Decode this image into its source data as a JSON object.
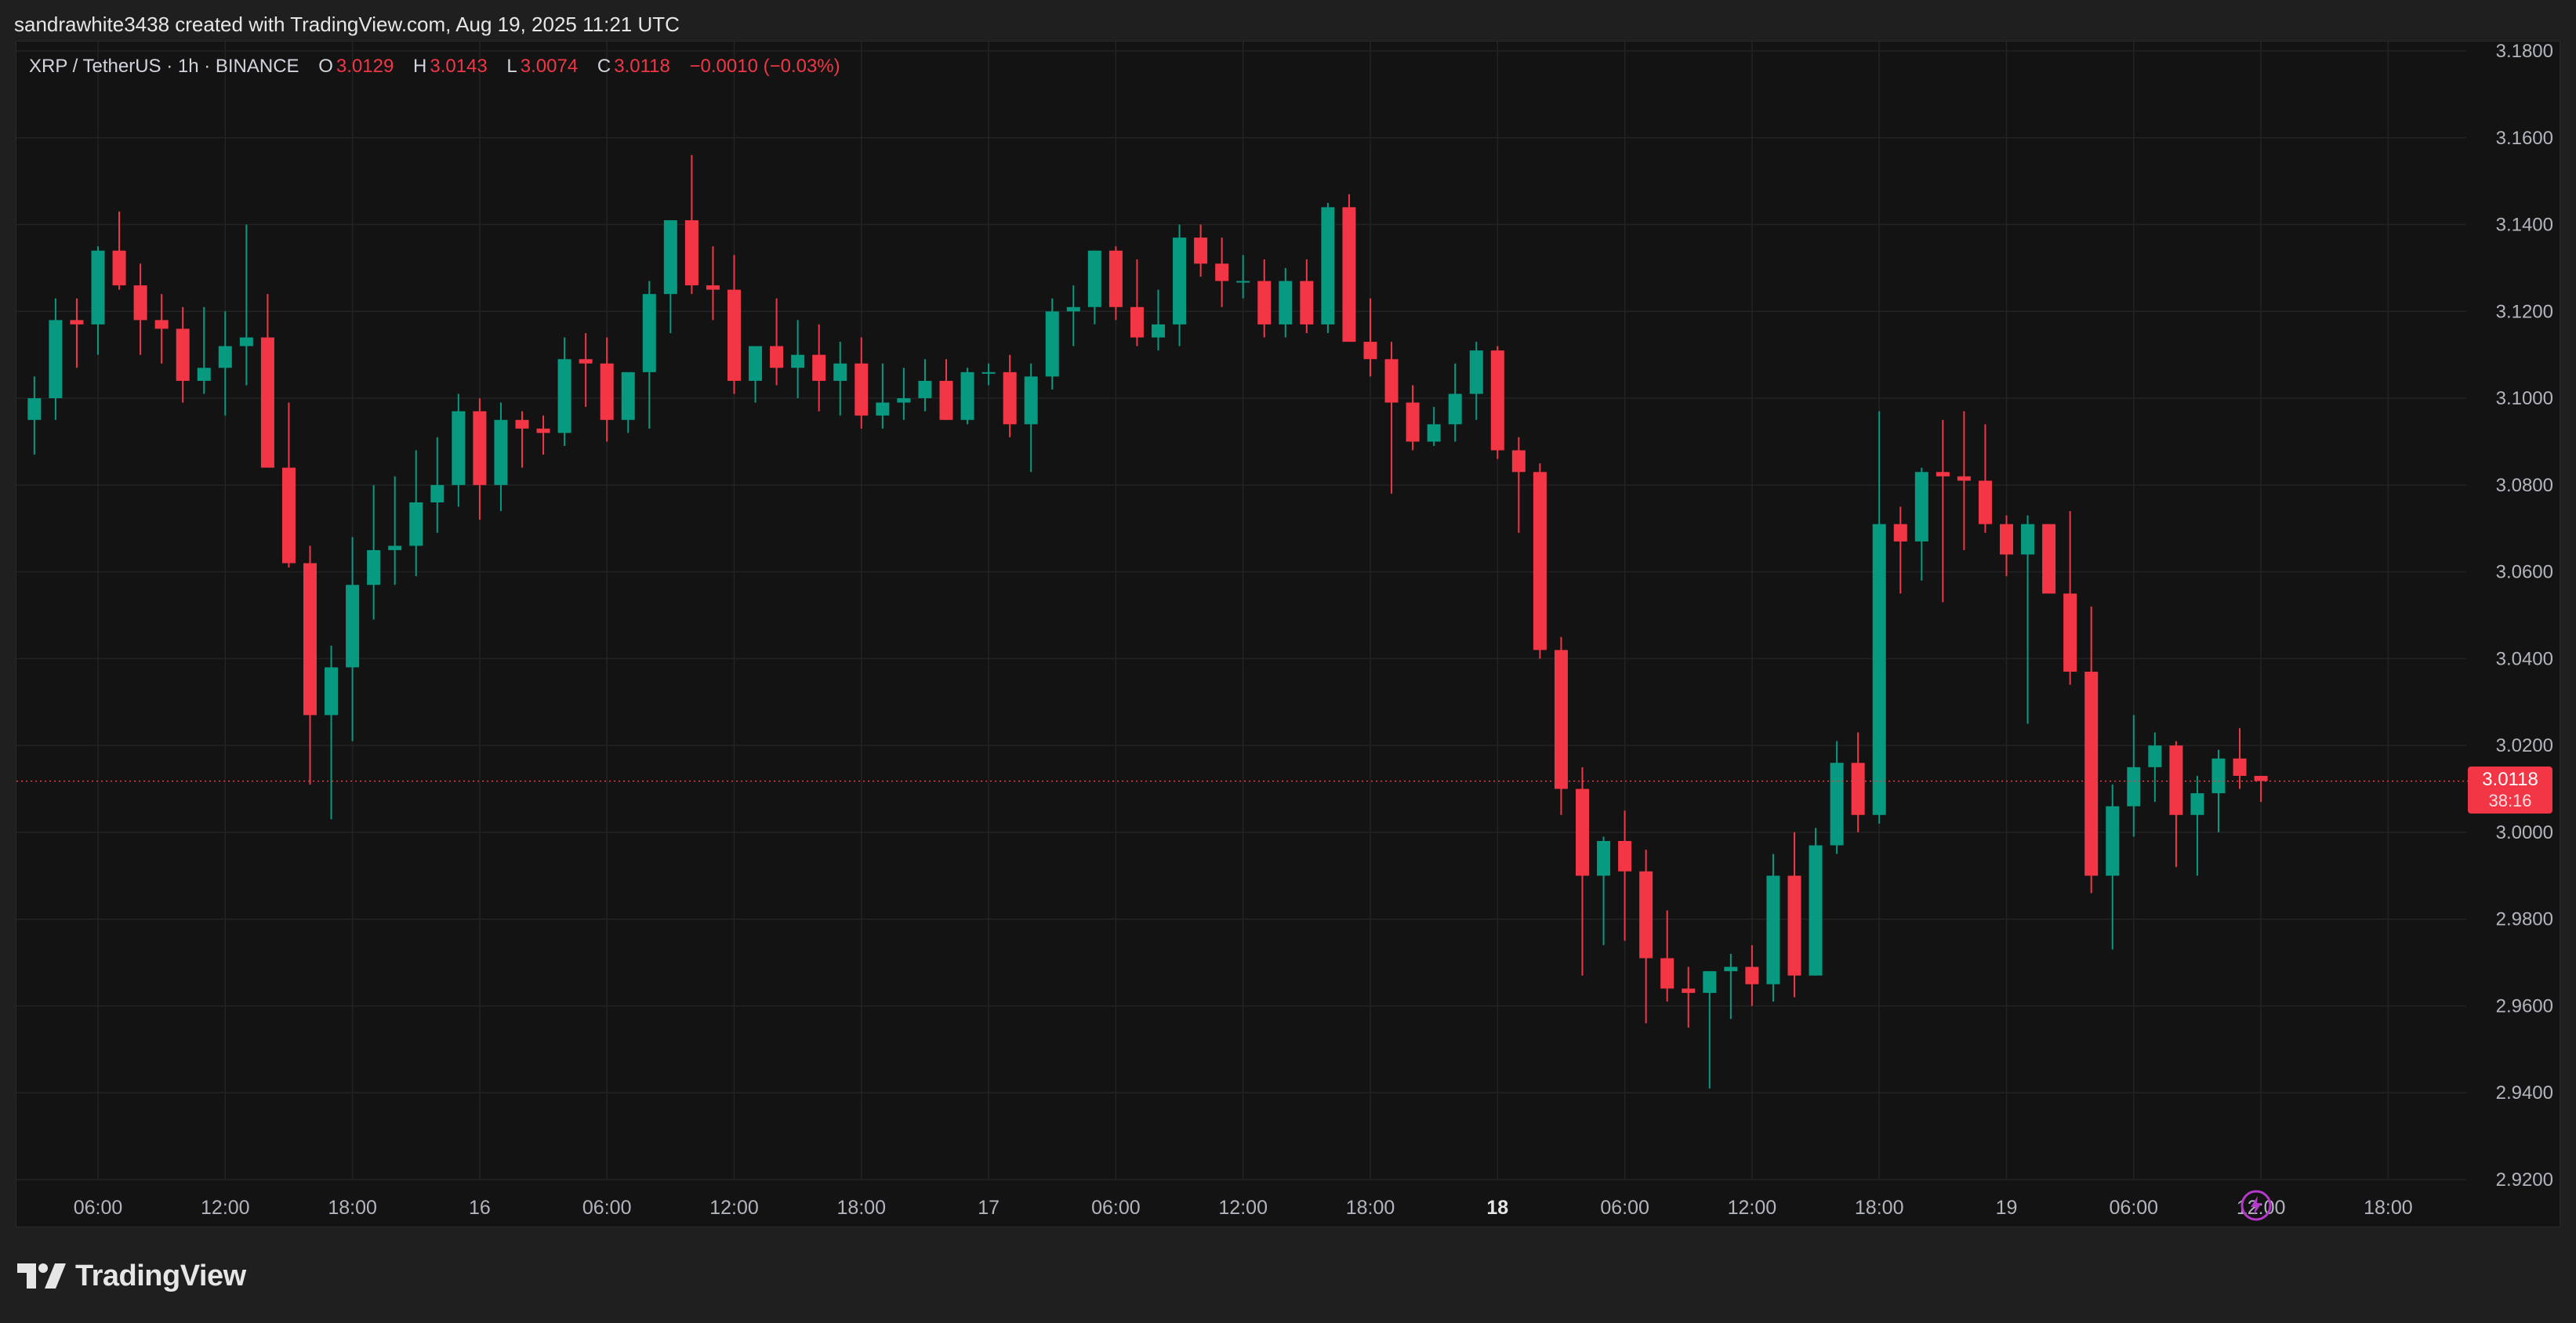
{
  "attribution": "sandrawhite3438 created with TradingView.com, Aug 19, 2025 11:21 UTC",
  "legend": {
    "symbol": "XRP / TetherUS · 1h · BINANCE",
    "o_label": "O",
    "o_value": "3.0129",
    "h_label": "H",
    "h_value": "3.0143",
    "l_label": "L",
    "l_value": "3.0074",
    "c_label": "C",
    "c_value": "3.0118",
    "change": "−0.0010 (−0.03%)"
  },
  "last_price": {
    "price": "3.0118",
    "countdown": "38:16"
  },
  "brand": "TradingView",
  "colors": {
    "up": "#089981",
    "down": "#f23645",
    "background": "#131313",
    "grid": "#232323",
    "axis_text": "#b2b5be"
  },
  "icons": {
    "replay": "lightning-icon",
    "logo": "tradingview-logo-icon"
  },
  "chart_data": {
    "type": "candlestick",
    "symbol": "XRP / TetherUS",
    "interval": "1h",
    "exchange": "BINANCE",
    "ylim": [
      2.92,
      3.18
    ],
    "y_ticks": [
      3.18,
      3.16,
      3.14,
      3.12,
      3.1,
      3.08,
      3.06,
      3.04,
      3.02,
      3.0,
      2.98,
      2.96,
      2.94,
      2.92
    ],
    "y_tick_labels": [
      "3.1800",
      "3.1600",
      "3.1400",
      "3.1200",
      "3.1000",
      "3.0800",
      "3.0600",
      "3.0400",
      "3.0200",
      "3.0000",
      "2.9800",
      "2.9600",
      "2.9400",
      "2.9200"
    ],
    "x_ticks": [
      {
        "label": "06:00",
        "hour": 6
      },
      {
        "label": "12:00",
        "hour": 12
      },
      {
        "label": "18:00",
        "hour": 18
      },
      {
        "label": "16",
        "hour": 24
      },
      {
        "label": "06:00",
        "hour": 30
      },
      {
        "label": "12:00",
        "hour": 36
      },
      {
        "label": "18:00",
        "hour": 42
      },
      {
        "label": "17",
        "hour": 48
      },
      {
        "label": "06:00",
        "hour": 54
      },
      {
        "label": "12:00",
        "hour": 60
      },
      {
        "label": "18:00",
        "hour": 66
      },
      {
        "label": "18",
        "hour": 72,
        "bold": true
      },
      {
        "label": "06:00",
        "hour": 78
      },
      {
        "label": "12:00",
        "hour": 84
      },
      {
        "label": "18:00",
        "hour": 90
      },
      {
        "label": "19",
        "hour": 96
      },
      {
        "label": "06:00",
        "hour": 102
      },
      {
        "label": "12:00",
        "hour": 108
      },
      {
        "label": "18:00",
        "hour": 114
      }
    ],
    "first_candle_hour": 3,
    "candles": [
      [
        3.095,
        3.105,
        3.087,
        3.1
      ],
      [
        3.1,
        3.123,
        3.095,
        3.118
      ],
      [
        3.118,
        3.123,
        3.107,
        3.117
      ],
      [
        3.117,
        3.135,
        3.11,
        3.134
      ],
      [
        3.134,
        3.143,
        3.125,
        3.126
      ],
      [
        3.126,
        3.131,
        3.11,
        3.118
      ],
      [
        3.118,
        3.124,
        3.108,
        3.116
      ],
      [
        3.116,
        3.121,
        3.099,
        3.104
      ],
      [
        3.104,
        3.121,
        3.101,
        3.107
      ],
      [
        3.107,
        3.12,
        3.096,
        3.112
      ],
      [
        3.112,
        3.14,
        3.103,
        3.114
      ],
      [
        3.114,
        3.124,
        3.096,
        3.084
      ],
      [
        3.084,
        3.099,
        3.061,
        3.062
      ],
      [
        3.062,
        3.066,
        3.011,
        3.027
      ],
      [
        3.027,
        3.043,
        3.003,
        3.038
      ],
      [
        3.038,
        3.068,
        3.021,
        3.057
      ],
      [
        3.057,
        3.08,
        3.049,
        3.065
      ],
      [
        3.065,
        3.082,
        3.057,
        3.066
      ],
      [
        3.066,
        3.088,
        3.059,
        3.076
      ],
      [
        3.076,
        3.091,
        3.069,
        3.08
      ],
      [
        3.08,
        3.101,
        3.075,
        3.097
      ],
      [
        3.097,
        3.1,
        3.072,
        3.08
      ],
      [
        3.08,
        3.099,
        3.074,
        3.095
      ],
      [
        3.095,
        3.097,
        3.084,
        3.093
      ],
      [
        3.093,
        3.096,
        3.087,
        3.092
      ],
      [
        3.092,
        3.114,
        3.089,
        3.109
      ],
      [
        3.109,
        3.115,
        3.098,
        3.108
      ],
      [
        3.108,
        3.114,
        3.09,
        3.095
      ],
      [
        3.095,
        3.103,
        3.092,
        3.106
      ],
      [
        3.106,
        3.127,
        3.093,
        3.124
      ],
      [
        3.124,
        3.141,
        3.115,
        3.141
      ],
      [
        3.141,
        3.156,
        3.124,
        3.126
      ],
      [
        3.126,
        3.135,
        3.118,
        3.125
      ],
      [
        3.125,
        3.133,
        3.101,
        3.104
      ],
      [
        3.104,
        3.111,
        3.099,
        3.112
      ],
      [
        3.112,
        3.123,
        3.103,
        3.107
      ],
      [
        3.107,
        3.118,
        3.1,
        3.11
      ],
      [
        3.11,
        3.117,
        3.097,
        3.104
      ],
      [
        3.104,
        3.113,
        3.096,
        3.108
      ],
      [
        3.108,
        3.114,
        3.093,
        3.096
      ],
      [
        3.096,
        3.108,
        3.093,
        3.099
      ],
      [
        3.099,
        3.107,
        3.095,
        3.1
      ],
      [
        3.1,
        3.109,
        3.097,
        3.104
      ],
      [
        3.104,
        3.109,
        3.095,
        3.095
      ],
      [
        3.095,
        3.107,
        3.094,
        3.106
      ],
      [
        3.106,
        3.108,
        3.103,
        3.106
      ],
      [
        3.106,
        3.11,
        3.091,
        3.094
      ],
      [
        3.094,
        3.108,
        3.083,
        3.105
      ],
      [
        3.105,
        3.123,
        3.102,
        3.12
      ],
      [
        3.12,
        3.126,
        3.112,
        3.121
      ],
      [
        3.121,
        3.134,
        3.117,
        3.134
      ],
      [
        3.134,
        3.135,
        3.118,
        3.121
      ],
      [
        3.121,
        3.132,
        3.112,
        3.114
      ],
      [
        3.114,
        3.125,
        3.111,
        3.117
      ],
      [
        3.117,
        3.14,
        3.112,
        3.137
      ],
      [
        3.137,
        3.14,
        3.128,
        3.131
      ],
      [
        3.131,
        3.137,
        3.121,
        3.127
      ],
      [
        3.127,
        3.133,
        3.123,
        3.127
      ],
      [
        3.127,
        3.132,
        3.114,
        3.117
      ],
      [
        3.117,
        3.13,
        3.114,
        3.127
      ],
      [
        3.127,
        3.132,
        3.115,
        3.117
      ],
      [
        3.117,
        3.145,
        3.115,
        3.144
      ],
      [
        3.144,
        3.147,
        3.113,
        3.113
      ],
      [
        3.113,
        3.123,
        3.105,
        3.109
      ],
      [
        3.109,
        3.113,
        3.078,
        3.099
      ],
      [
        3.099,
        3.103,
        3.088,
        3.09
      ],
      [
        3.09,
        3.098,
        3.089,
        3.094
      ],
      [
        3.094,
        3.108,
        3.09,
        3.101
      ],
      [
        3.101,
        3.113,
        3.095,
        3.111
      ],
      [
        3.111,
        3.112,
        3.086,
        3.088
      ],
      [
        3.088,
        3.091,
        3.069,
        3.083
      ],
      [
        3.083,
        3.085,
        3.04,
        3.042
      ],
      [
        3.042,
        3.045,
        3.004,
        3.01
      ],
      [
        3.01,
        3.015,
        2.967,
        2.99
      ],
      [
        2.99,
        2.999,
        2.974,
        2.998
      ],
      [
        2.998,
        3.005,
        2.975,
        2.991
      ],
      [
        2.991,
        2.996,
        2.956,
        2.971
      ],
      [
        2.971,
        2.982,
        2.961,
        2.964
      ],
      [
        2.964,
        2.969,
        2.955,
        2.963
      ],
      [
        2.963,
        2.968,
        2.941,
        2.968
      ],
      [
        2.968,
        2.972,
        2.957,
        2.969
      ],
      [
        2.969,
        2.974,
        2.96,
        2.965
      ],
      [
        2.965,
        2.995,
        2.961,
        2.99
      ],
      [
        2.99,
        3.0,
        2.962,
        2.967
      ],
      [
        2.967,
        3.001,
        2.967,
        2.997
      ],
      [
        2.997,
        3.021,
        2.995,
        3.016
      ],
      [
        3.016,
        3.023,
        3.0,
        3.004
      ],
      [
        3.004,
        3.097,
        3.002,
        3.071
      ],
      [
        3.071,
        3.075,
        3.055,
        3.067
      ],
      [
        3.067,
        3.084,
        3.058,
        3.083
      ],
      [
        3.083,
        3.095,
        3.053,
        3.082
      ],
      [
        3.082,
        3.097,
        3.065,
        3.081
      ],
      [
        3.081,
        3.094,
        3.069,
        3.071
      ],
      [
        3.071,
        3.073,
        3.059,
        3.064
      ],
      [
        3.064,
        3.073,
        3.025,
        3.071
      ],
      [
        3.071,
        3.071,
        3.056,
        3.055
      ],
      [
        3.055,
        3.074,
        3.034,
        3.037
      ],
      [
        3.037,
        3.052,
        2.986,
        2.99
      ],
      [
        2.99,
        3.011,
        2.973,
        3.006
      ],
      [
        3.006,
        3.027,
        2.999,
        3.015
      ],
      [
        3.015,
        3.023,
        3.007,
        3.02
      ],
      [
        3.02,
        3.021,
        2.992,
        3.004
      ],
      [
        3.004,
        3.013,
        2.99,
        3.009
      ],
      [
        3.009,
        3.019,
        3.0,
        3.017
      ],
      [
        3.017,
        3.024,
        3.01,
        3.013
      ],
      [
        3.013,
        3.013,
        3.007,
        3.0118
      ]
    ],
    "last_price": 3.0118
  }
}
